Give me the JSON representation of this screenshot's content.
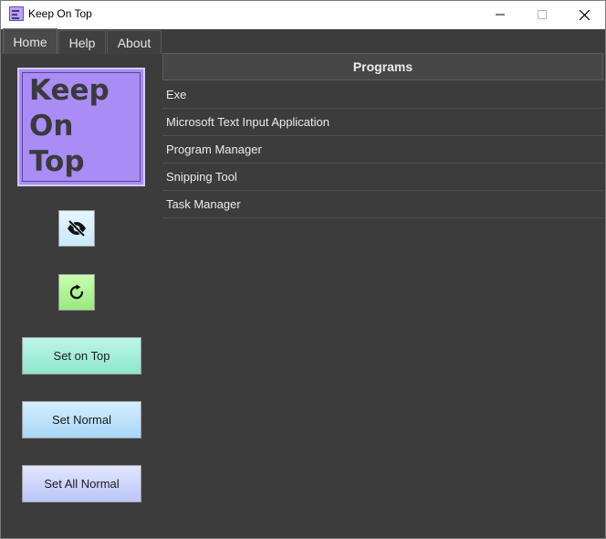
{
  "window": {
    "title": "Keep On Top",
    "icon": "keep-on-top-app-icon",
    "controls": [
      "minimize-icon",
      "maximize-icon",
      "close-icon"
    ]
  },
  "tabs": [
    {
      "label": "Home",
      "active": true
    },
    {
      "label": "Help",
      "active": false
    },
    {
      "label": "About",
      "active": false
    }
  ],
  "logo": {
    "lines": [
      "Keep",
      "On",
      "Top"
    ],
    "background": "#a98cf6"
  },
  "icons": {
    "hide": "eye-slash-icon",
    "refresh": "refresh-icon"
  },
  "buttons": {
    "set_on_top": "Set on Top",
    "set_normal": "Set Normal",
    "set_all_normal": "Set All Normal"
  },
  "programs": {
    "header": "Programs",
    "items": [
      "Exe",
      "Microsoft Text Input Application",
      "Program Manager",
      "Snipping Tool",
      "Task Manager"
    ]
  },
  "colors": {
    "background": "#3c3c3c",
    "text": "#ececec",
    "set_on_top_button": "#8ee6cc",
    "set_normal_button": "#a9d6f6",
    "set_all_normal_button": "#bcc6f6",
    "hide_button": "#c8e8f8",
    "refresh_button": "#98e880"
  }
}
